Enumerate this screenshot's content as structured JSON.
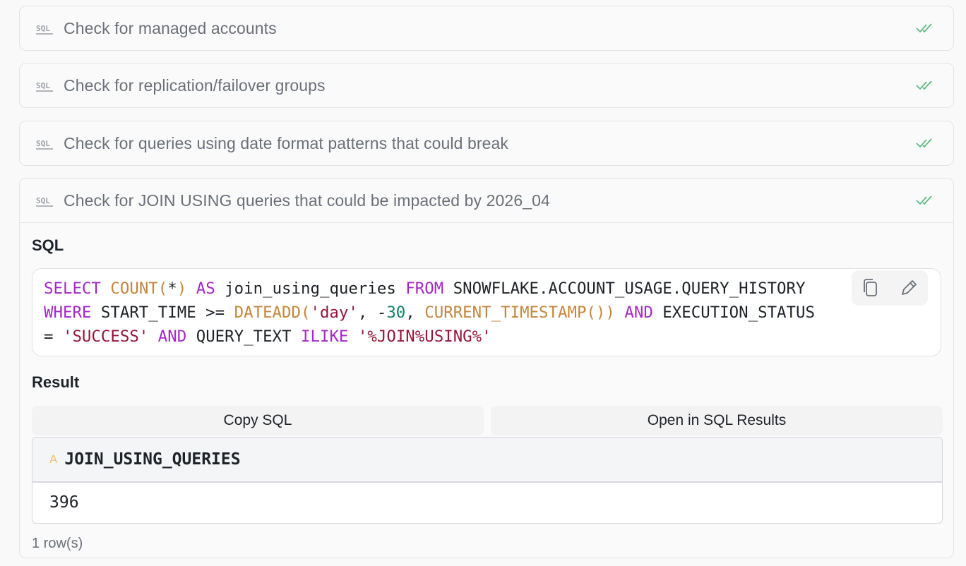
{
  "steps": [
    {
      "title": "Check for managed accounts"
    },
    {
      "title": "Check for replication/failover groups"
    },
    {
      "title": "Check for queries using date format patterns that could break"
    },
    {
      "title": "Check for JOIN USING queries that could be impacted by 2026_04"
    }
  ],
  "icons": {
    "step_icon": "sql-icon",
    "status_icon": "double-check-icon",
    "copy": "copy-icon",
    "edit": "pencil-icon",
    "column_type": "text-type-icon"
  },
  "colors": {
    "check": "#5dbb82",
    "keyword": "#a626c9",
    "function": "#c4863c",
    "string": "#94163a",
    "number": "#11806a"
  },
  "detail": {
    "sql_label": "SQL",
    "result_label": "Result",
    "sql_text": "SELECT COUNT(*) AS join_using_queries FROM SNOWFLAKE.ACCOUNT_USAGE.QUERY_HISTORY WHERE START_TIME >= DATEADD('day', -30, CURRENT_TIMESTAMP()) AND EXECUTION_STATUS = 'SUCCESS' AND QUERY_TEXT ILIKE '%JOIN%USING%'",
    "copy_sql_label": "Copy SQL",
    "open_results_label": "Open in SQL Results",
    "table": {
      "type_icon": "A",
      "column": "JOIN_USING_QUERIES",
      "rows": [
        "396"
      ]
    },
    "row_count": "1 row(s)"
  }
}
